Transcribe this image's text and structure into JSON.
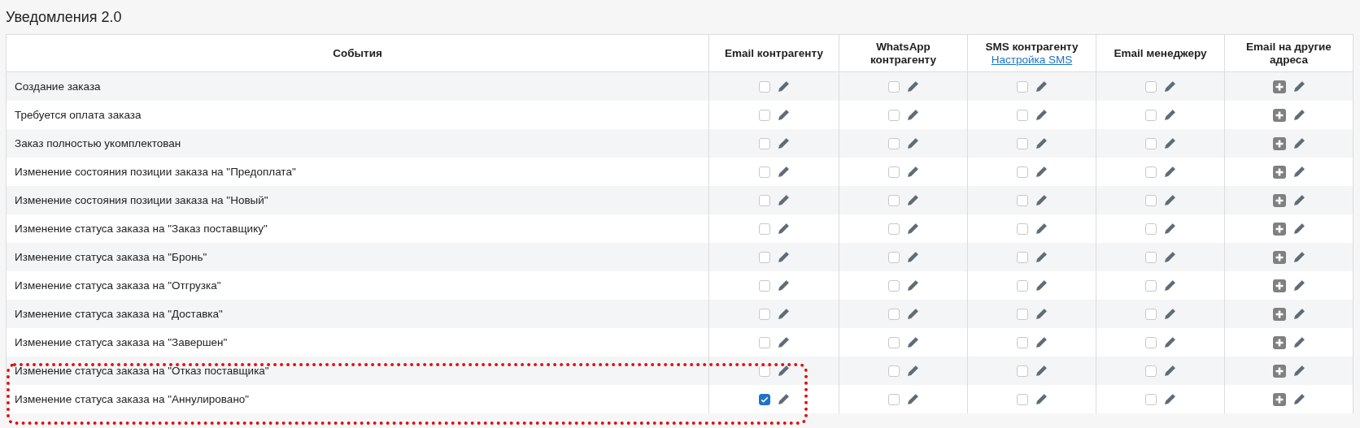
{
  "title": "Уведомления 2.0",
  "columns": [
    {
      "label": "События"
    },
    {
      "label": "Email контрагенту"
    },
    {
      "label": "WhatsApp контрагенту"
    },
    {
      "label": "SMS контрагенту",
      "link": "Настройка SMS"
    },
    {
      "label": "Email менеджеру"
    },
    {
      "label": "Email на другие адреса"
    }
  ],
  "rows": [
    {
      "event": "Создание заказа",
      "highlighted": false,
      "cells": [
        {
          "kind": "checkbox",
          "checked": false
        },
        {
          "kind": "checkbox",
          "checked": false
        },
        {
          "kind": "checkbox",
          "checked": false
        },
        {
          "kind": "checkbox",
          "checked": false
        },
        {
          "kind": "add"
        }
      ]
    },
    {
      "event": "Требуется оплата заказа",
      "highlighted": false,
      "cells": [
        {
          "kind": "checkbox",
          "checked": false
        },
        {
          "kind": "checkbox",
          "checked": false
        },
        {
          "kind": "checkbox",
          "checked": false
        },
        {
          "kind": "checkbox",
          "checked": false
        },
        {
          "kind": "add"
        }
      ]
    },
    {
      "event": "Заказ полностью укомплектован",
      "highlighted": false,
      "cells": [
        {
          "kind": "checkbox",
          "checked": false
        },
        {
          "kind": "checkbox",
          "checked": false
        },
        {
          "kind": "checkbox",
          "checked": false
        },
        {
          "kind": "checkbox",
          "checked": false
        },
        {
          "kind": "add"
        }
      ]
    },
    {
      "event": "Изменение состояния позиции заказа на \"Предоплата\"",
      "highlighted": false,
      "cells": [
        {
          "kind": "checkbox",
          "checked": false
        },
        {
          "kind": "checkbox",
          "checked": false
        },
        {
          "kind": "checkbox",
          "checked": false
        },
        {
          "kind": "checkbox",
          "checked": false
        },
        {
          "kind": "add"
        }
      ]
    },
    {
      "event": "Изменение состояния позиции заказа на \"Новый\"",
      "highlighted": false,
      "cells": [
        {
          "kind": "checkbox",
          "checked": false
        },
        {
          "kind": "checkbox",
          "checked": false
        },
        {
          "kind": "checkbox",
          "checked": false
        },
        {
          "kind": "checkbox",
          "checked": false
        },
        {
          "kind": "add"
        }
      ]
    },
    {
      "event": "Изменение статуса заказа на \"Заказ поставщику\"",
      "highlighted": false,
      "cells": [
        {
          "kind": "checkbox",
          "checked": false
        },
        {
          "kind": "checkbox",
          "checked": false
        },
        {
          "kind": "checkbox",
          "checked": false
        },
        {
          "kind": "checkbox",
          "checked": false
        },
        {
          "kind": "add"
        }
      ]
    },
    {
      "event": "Изменение статуса заказа на \"Бронь\"",
      "highlighted": false,
      "cells": [
        {
          "kind": "checkbox",
          "checked": false
        },
        {
          "kind": "checkbox",
          "checked": false
        },
        {
          "kind": "checkbox",
          "checked": false
        },
        {
          "kind": "checkbox",
          "checked": false
        },
        {
          "kind": "add"
        }
      ]
    },
    {
      "event": "Изменение статуса заказа на \"Отгрузка\"",
      "highlighted": false,
      "cells": [
        {
          "kind": "checkbox",
          "checked": false
        },
        {
          "kind": "checkbox",
          "checked": false
        },
        {
          "kind": "checkbox",
          "checked": false
        },
        {
          "kind": "checkbox",
          "checked": false
        },
        {
          "kind": "add"
        }
      ]
    },
    {
      "event": "Изменение статуса заказа на \"Доставка\"",
      "highlighted": false,
      "cells": [
        {
          "kind": "checkbox",
          "checked": false
        },
        {
          "kind": "checkbox",
          "checked": false
        },
        {
          "kind": "checkbox",
          "checked": false
        },
        {
          "kind": "checkbox",
          "checked": false
        },
        {
          "kind": "add"
        }
      ]
    },
    {
      "event": "Изменение статуса заказа на \"Завершен\"",
      "highlighted": false,
      "cells": [
        {
          "kind": "checkbox",
          "checked": false
        },
        {
          "kind": "checkbox",
          "checked": false
        },
        {
          "kind": "checkbox",
          "checked": false
        },
        {
          "kind": "checkbox",
          "checked": false
        },
        {
          "kind": "add"
        }
      ]
    },
    {
      "event": "Изменение статуса заказа на \"Отказ поставщика\"",
      "highlighted": true,
      "cells": [
        {
          "kind": "checkbox",
          "checked": false
        },
        {
          "kind": "checkbox",
          "checked": false
        },
        {
          "kind": "checkbox",
          "checked": false
        },
        {
          "kind": "checkbox",
          "checked": false
        },
        {
          "kind": "add"
        }
      ]
    },
    {
      "event": "Изменение статуса заказа на \"Аннулировано\"",
      "highlighted": true,
      "cells": [
        {
          "kind": "checkbox",
          "checked": true
        },
        {
          "kind": "checkbox",
          "checked": false
        },
        {
          "kind": "checkbox",
          "checked": false
        },
        {
          "kind": "checkbox",
          "checked": false
        },
        {
          "kind": "add"
        }
      ]
    }
  ]
}
